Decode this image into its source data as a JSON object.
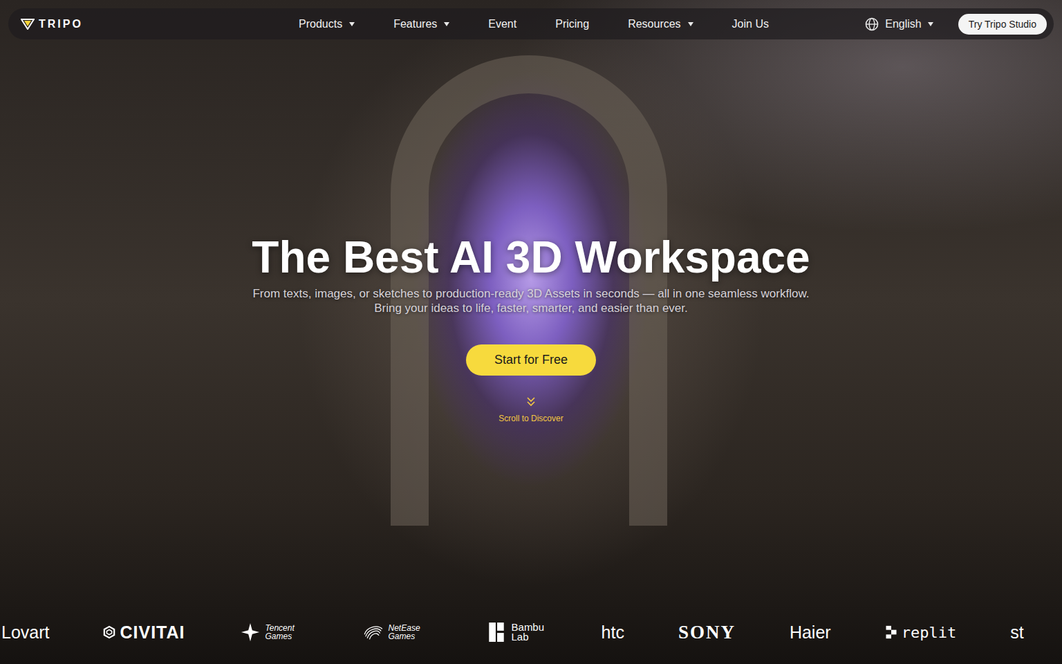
{
  "nav": {
    "logo": "TRIPO",
    "items": [
      {
        "label": "Products",
        "has_menu": true
      },
      {
        "label": "Features",
        "has_menu": true
      },
      {
        "label": "Event",
        "has_menu": false
      },
      {
        "label": "Pricing",
        "has_menu": false
      },
      {
        "label": "Resources",
        "has_menu": true
      },
      {
        "label": "Join Us",
        "has_menu": false
      }
    ],
    "language": {
      "label": "English",
      "has_menu": true
    },
    "cta": "Try Tripo Studio"
  },
  "hero": {
    "title": "The Best AI 3D Workspace",
    "subtitle_lines": [
      "From texts, images, or sketches to production-ready 3D Assets in seconds — all in one seamless workflow.",
      "Bring your ideas to life, faster, smarter, and easier than ever."
    ],
    "cta": "Start for Free",
    "scroll_hint": "Scroll to Discover"
  },
  "partners": [
    {
      "name": "Lovart",
      "kind": "wordmark"
    },
    {
      "name": "CIVITAI",
      "kind": "hex"
    },
    {
      "name": "Tencent Games",
      "kind": "star"
    },
    {
      "name": "NetEase Games",
      "kind": "swirl"
    },
    {
      "name": "Bambu Lab",
      "kind": "blocks"
    },
    {
      "name": "htc",
      "kind": "wordmark"
    },
    {
      "name": "SONY",
      "kind": "serif"
    },
    {
      "name": "Haier",
      "kind": "wordmark"
    },
    {
      "name": "replit",
      "kind": "replit"
    },
    {
      "name": "st",
      "kind": "wordmark"
    }
  ]
}
